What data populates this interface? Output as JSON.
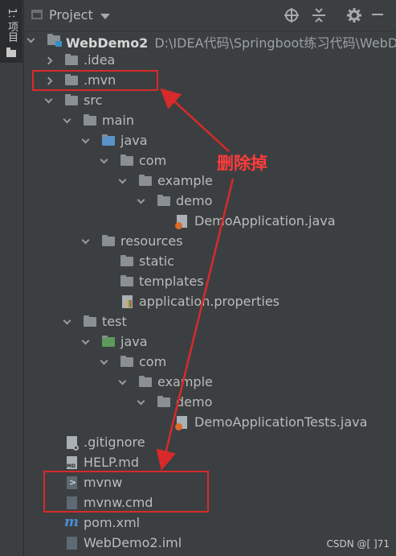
{
  "sidebar": {
    "tab_label": "1: 项目"
  },
  "header": {
    "title": "Project"
  },
  "tree": {
    "root_name": "WebDemo2",
    "root_path": "D:\\IDEA代码\\Springboot练习代码\\WebDe",
    "items": [
      {
        "label": ".idea"
      },
      {
        "label": ".mvn"
      },
      {
        "label": "src"
      },
      {
        "label": "main"
      },
      {
        "label": "java"
      },
      {
        "label": "com"
      },
      {
        "label": "example"
      },
      {
        "label": "demo"
      },
      {
        "label": "DemoApplication.java"
      },
      {
        "label": "resources"
      },
      {
        "label": "static"
      },
      {
        "label": "templates"
      },
      {
        "label": "application.properties"
      },
      {
        "label": "test"
      },
      {
        "label": "java"
      },
      {
        "label": "com"
      },
      {
        "label": "example"
      },
      {
        "label": "demo"
      },
      {
        "label": "DemoApplicationTests.java"
      },
      {
        "label": ".gitignore"
      },
      {
        "label": "HELP.md"
      },
      {
        "label": "mvnw"
      },
      {
        "label": "mvnw.cmd"
      },
      {
        "label": "pom.xml"
      },
      {
        "label": "WebDemo2.iml"
      }
    ]
  },
  "annotation": {
    "text": "删除掉",
    "color": "#ff3b3b"
  },
  "watermark": {
    "text": "CSDN @[     ]71"
  },
  "colors": {
    "panel": "#3c3f41",
    "text": "#bbbbbb",
    "folder": "#8a8f94",
    "annotation_red": "#d82a2a"
  }
}
